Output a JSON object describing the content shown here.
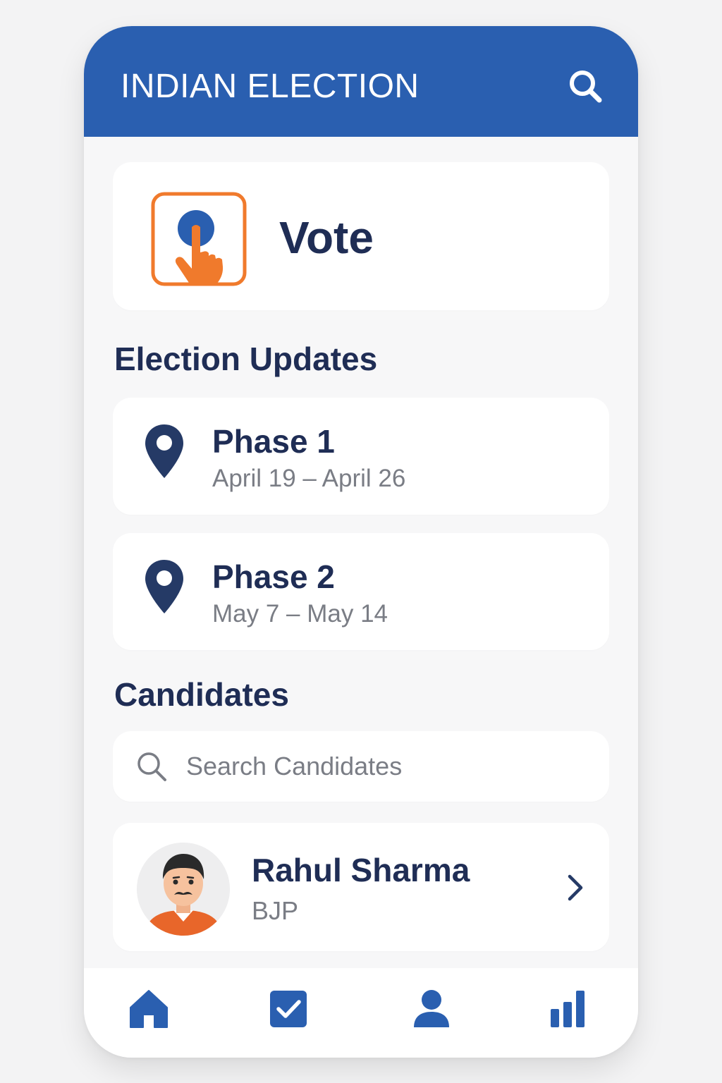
{
  "header": {
    "title": "INDIAN ELECTION",
    "search_icon": "search-icon"
  },
  "vote_card": {
    "label": "Vote",
    "icon": "vote-hand-icon",
    "colors": {
      "accent": "#f07a2c",
      "dot": "#2a5fb0"
    }
  },
  "updates": {
    "title": "Election Updates",
    "phases": [
      {
        "name": "Phase 1",
        "dates": "April 19 – April 26",
        "icon": "location-pin-icon"
      },
      {
        "name": "Phase 2",
        "dates": "May 7 – May 14",
        "icon": "location-pin-icon"
      }
    ]
  },
  "candidates": {
    "title": "Candidates",
    "search": {
      "placeholder": "Search Candidates",
      "value": ""
    },
    "list": [
      {
        "name": "Rahul Sharma",
        "party": "BJP",
        "icon": "avatar"
      }
    ]
  },
  "bottom_nav": [
    {
      "id": "home",
      "icon": "home-icon"
    },
    {
      "id": "vote",
      "icon": "checkbox-icon"
    },
    {
      "id": "profile",
      "icon": "user-icon"
    },
    {
      "id": "stats",
      "icon": "bar-chart-icon"
    }
  ],
  "colors": {
    "primary": "#2a5fb0",
    "text_dark": "#1f2d55",
    "text_muted": "#7a7d85",
    "accent_orange": "#f07a2c"
  }
}
